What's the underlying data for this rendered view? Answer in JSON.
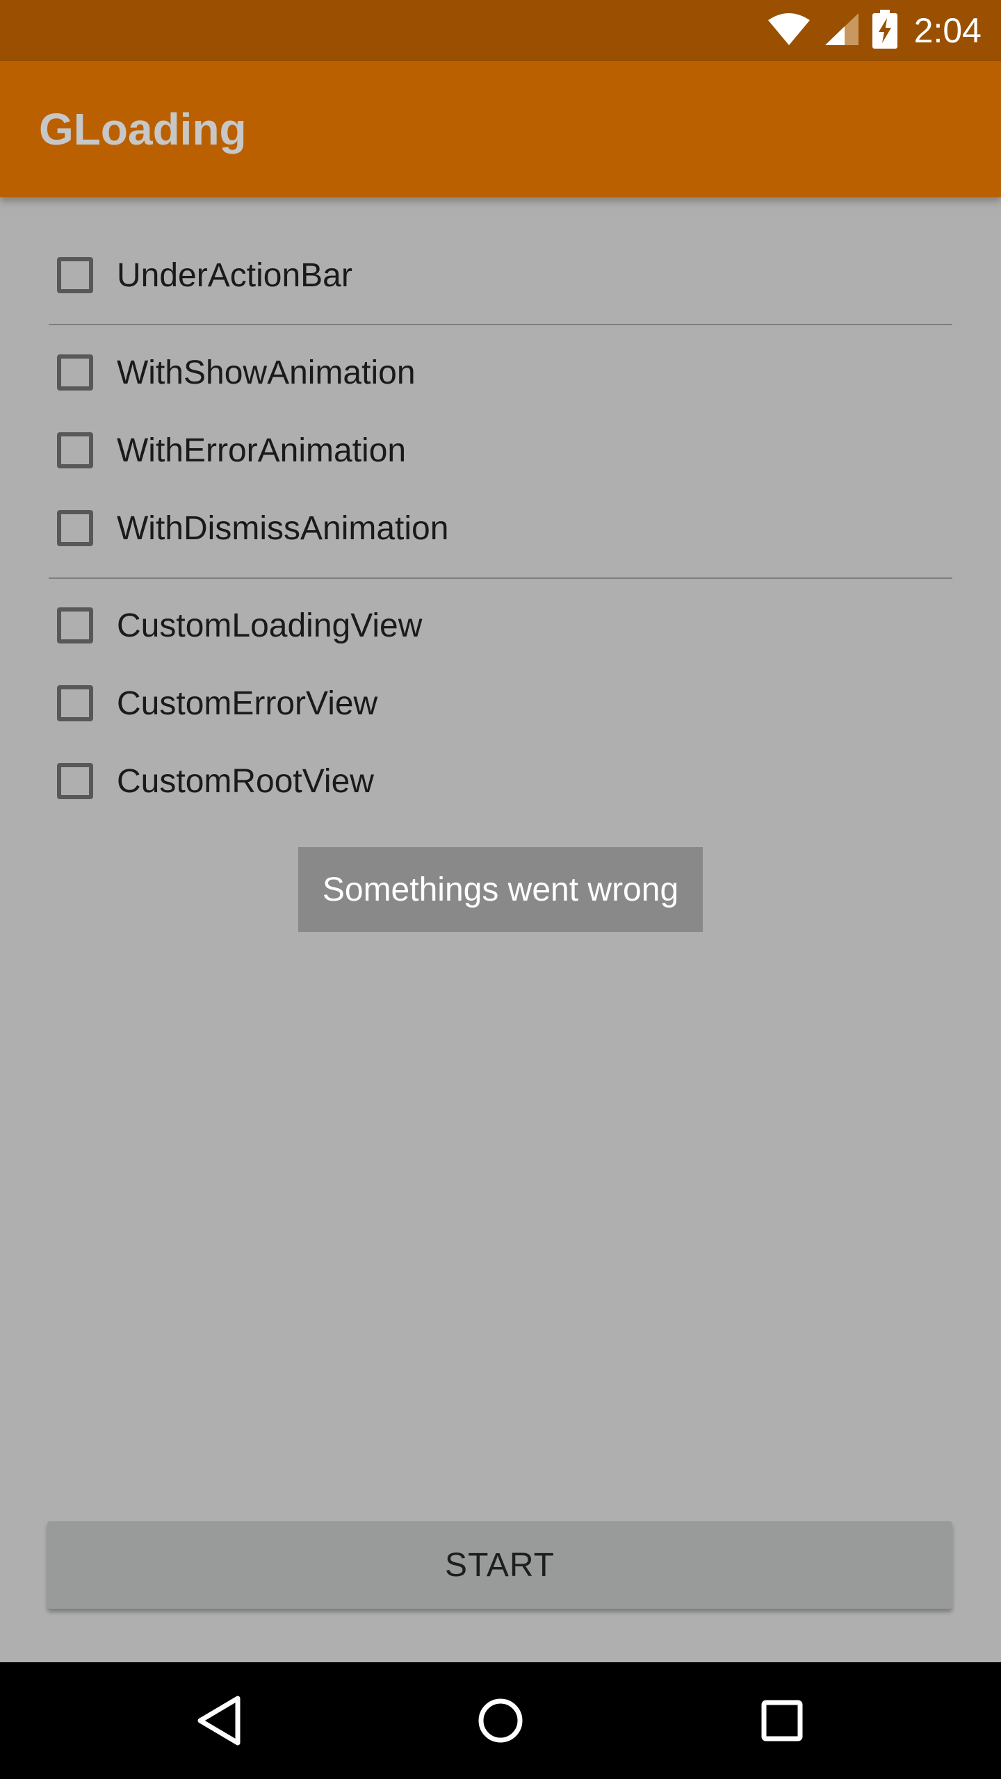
{
  "status_bar": {
    "time": "2:04",
    "icons": [
      "wifi-icon",
      "signal-icon",
      "battery-charging-icon"
    ]
  },
  "toolbar": {
    "title": "GLoading"
  },
  "options": {
    "group1": [
      {
        "label": "UnderActionBar",
        "checked": false
      }
    ],
    "group2": [
      {
        "label": "WithShowAnimation",
        "checked": false
      },
      {
        "label": "WithErrorAnimation",
        "checked": false
      },
      {
        "label": "WithDismissAnimation",
        "checked": false
      }
    ],
    "group3": [
      {
        "label": "CustomLoadingView",
        "checked": false
      },
      {
        "label": "CustomErrorView",
        "checked": false
      },
      {
        "label": "CustomRootView",
        "checked": false
      }
    ]
  },
  "toast": {
    "message": "Somethings went wrong"
  },
  "start_button": {
    "label": "START"
  },
  "nav_bar": {
    "icons": [
      "back-icon",
      "home-icon",
      "recents-icon"
    ]
  },
  "colors": {
    "status_bar": "#9a5000",
    "toolbar": "#bb6000",
    "background": "#afafaf",
    "toast": "#898989",
    "button": "#999b9b"
  }
}
